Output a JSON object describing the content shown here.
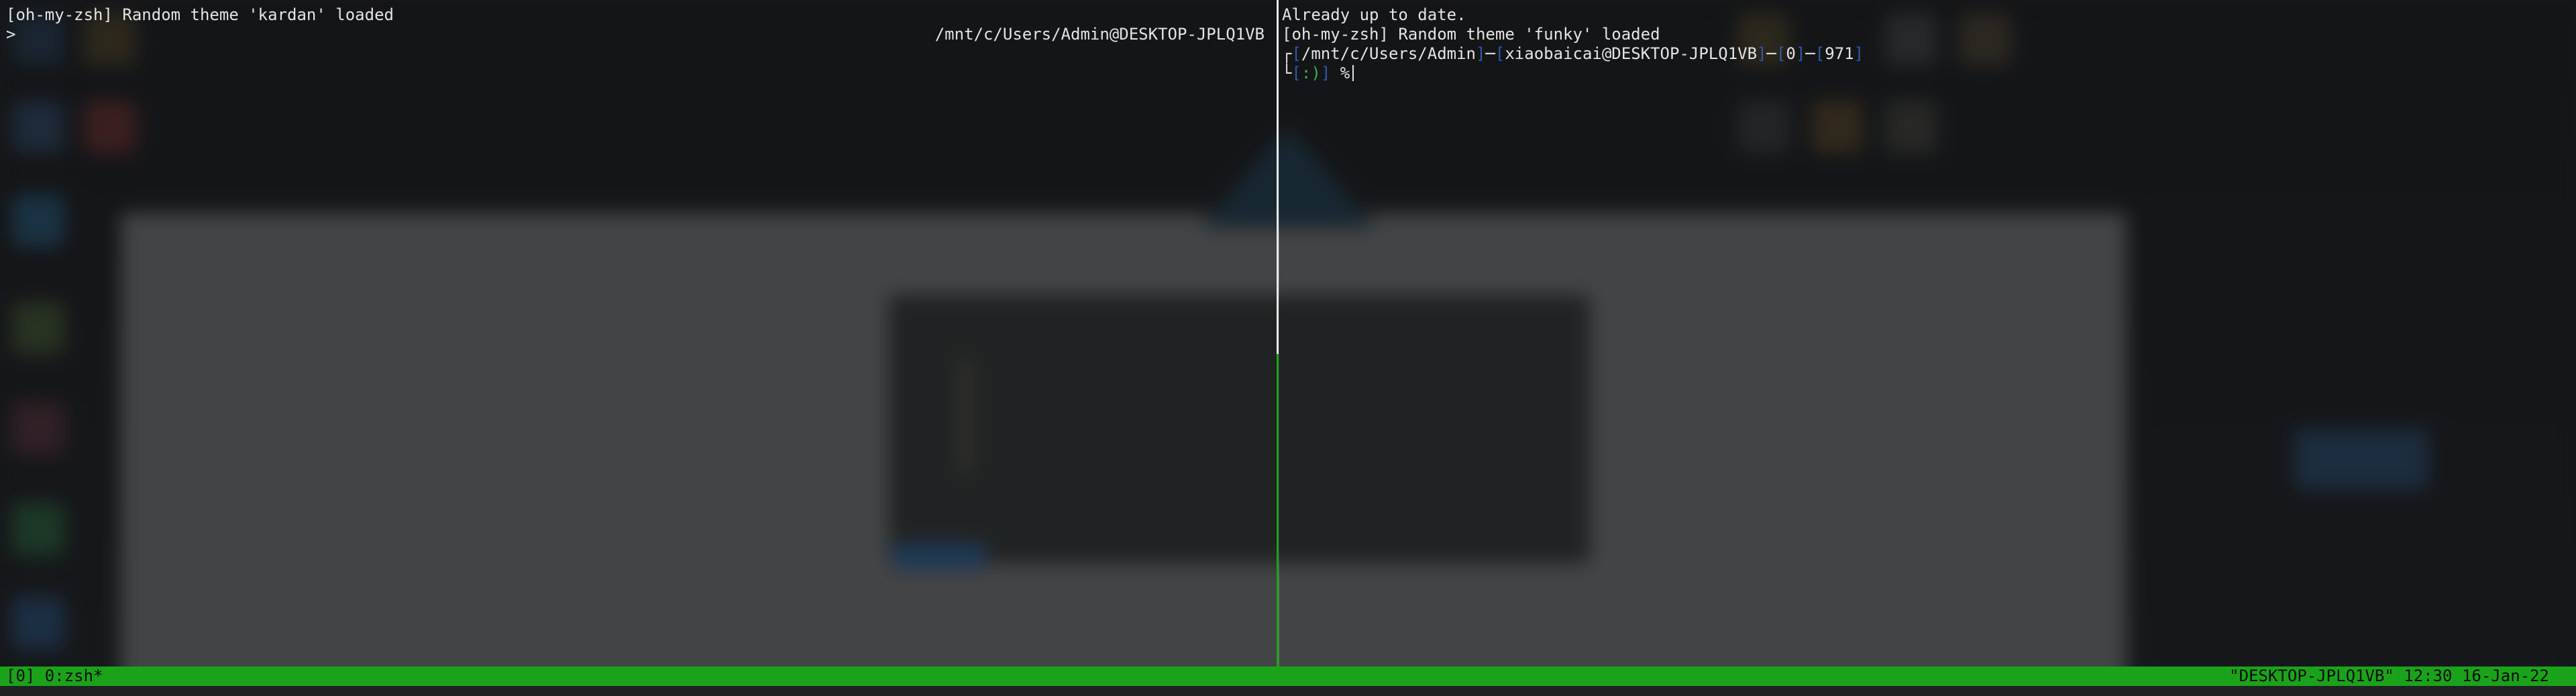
{
  "left_pane": {
    "line1": "[oh-my-zsh] Random theme 'kardan' loaded",
    "prompt": ">",
    "right_prompt": "/mnt/c/Users/Admin@DESKTOP-JPLQ1VB"
  },
  "right_pane": {
    "line1": "Already up to date.",
    "line2": "[oh-my-zsh] Random theme 'funky' loaded",
    "prompt": {
      "corner_top": "┌",
      "path": "/mnt/c/Users/Admin",
      "dash": "─",
      "user_host": "xiaobaicai@DESKTOP-JPLQ1VB",
      "exit_code": "0",
      "history_number": "971",
      "corner_bottom": "└",
      "smiley": ":)",
      "symbol": "%"
    }
  },
  "status_bar": {
    "left": "[0] 0:zsh*",
    "right": "\"DESKTOP-JPLQ1VB\" 12:30 16-Jan-22"
  },
  "colors": {
    "status_bar": "#1aa31a",
    "active_divider": "#1aa31a",
    "bracket_blue": "#2f59a8",
    "smiley_green": "#3bb54a"
  }
}
